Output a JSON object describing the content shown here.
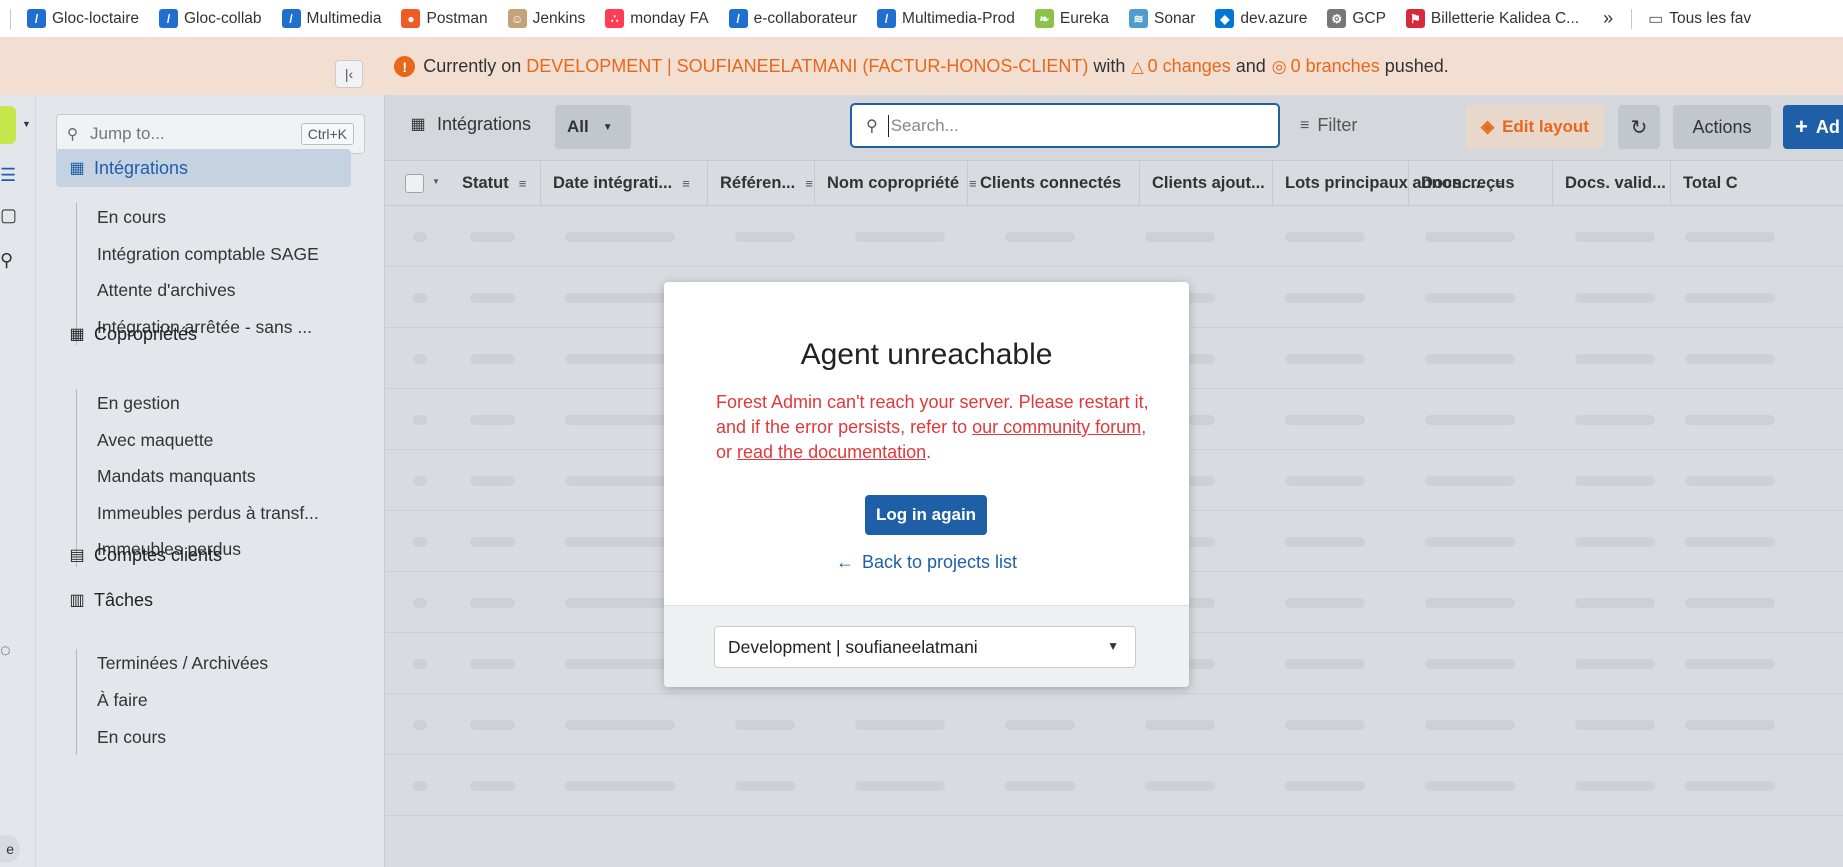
{
  "bookmarks": {
    "items": [
      {
        "label": "Gloc-loctaire",
        "icon": "slash-icon",
        "color": "#1f6fd0"
      },
      {
        "label": "Gloc-collab",
        "icon": "slash-icon",
        "color": "#1f6fd0"
      },
      {
        "label": "Multimedia",
        "icon": "slash-icon",
        "color": "#1f6fd0"
      },
      {
        "label": "Postman",
        "icon": "postman-icon",
        "color": "#ef5b25"
      },
      {
        "label": "Jenkins",
        "icon": "jenkins-icon",
        "color": "#c4a27a"
      },
      {
        "label": "monday FA",
        "icon": "monday-icon",
        "color": "#ff3d57"
      },
      {
        "label": "e-collaborateur",
        "icon": "slash-icon",
        "color": "#1f6fd0"
      },
      {
        "label": "Multimedia-Prod",
        "icon": "slash-icon",
        "color": "#1f6fd0"
      },
      {
        "label": "Eureka",
        "icon": "leaf-icon",
        "color": "#8bc34a"
      },
      {
        "label": "Sonar",
        "icon": "sonar-icon",
        "color": "#4e9bcd"
      },
      {
        "label": "dev.azure",
        "icon": "azure-icon",
        "color": "#0078d4"
      },
      {
        "label": "GCP",
        "icon": "gear-icon",
        "color": "#777777"
      },
      {
        "label": "Billetterie Kalidea C...",
        "icon": "flag-icon",
        "color": "#d62b3a"
      }
    ],
    "more": "»",
    "folder_label": "Tous les fav"
  },
  "banner": {
    "prefix": "Currently on",
    "environment": "DEVELOPMENT | SOUFIANEELATMANI (FACTUR-HONOS-CLIENT)",
    "with": "with",
    "changes": "0 changes",
    "and": "and",
    "branches": "0 branches",
    "suffix": "pushed.",
    "accent": "#e8671a"
  },
  "sidebar": {
    "jump_placeholder": "Jump to...",
    "jump_shortcut": "Ctrl+K",
    "groups": [
      {
        "label": "Intégrations",
        "active": true,
        "subs": [
          "En cours",
          "Intégration comptable SAGE",
          "Attente d'archives",
          "Intégration arrêtée - sans ..."
        ]
      },
      {
        "label": "Copropriétés",
        "active": false,
        "subs": [
          "En gestion",
          "Avec maquette",
          "Mandats manquants",
          "Immeubles perdus à transf...",
          "Immeubles perdus"
        ]
      },
      {
        "label": "Comptes clients",
        "active": false,
        "subs": []
      },
      {
        "label": "Tâches",
        "active": false,
        "subs": [
          "Terminées / Archivées",
          "À faire",
          "En cours"
        ]
      }
    ],
    "avatar_letter": "e"
  },
  "toolbar": {
    "collection": "Intégrations",
    "segment": "All",
    "search_placeholder": "Search...",
    "filter": "Filter",
    "edit_layout": "Edit layout",
    "actions": "Actions",
    "add": "Ad"
  },
  "table": {
    "columns": [
      "Statut",
      "Date intégrati...",
      "Référen...",
      "Nom copropriété",
      "Clients connectés",
      "Clients ajout...",
      "Lots principaux annonc...",
      "Docs. reçus",
      "Docs. valid...",
      "Total C"
    ]
  },
  "modal": {
    "title": "Agent unreachable",
    "message_start": "Forest Admin can't reach your server. Please restart it, and if the error persists, refer to",
    "link_forum": "our community forum",
    "message_mid": ", or",
    "link_docs": "read the documentation",
    "message_end": ".",
    "login_button": "Log in again",
    "back_link": "Back to projects list",
    "environment_select": "Development | soufianeelatmani"
  }
}
